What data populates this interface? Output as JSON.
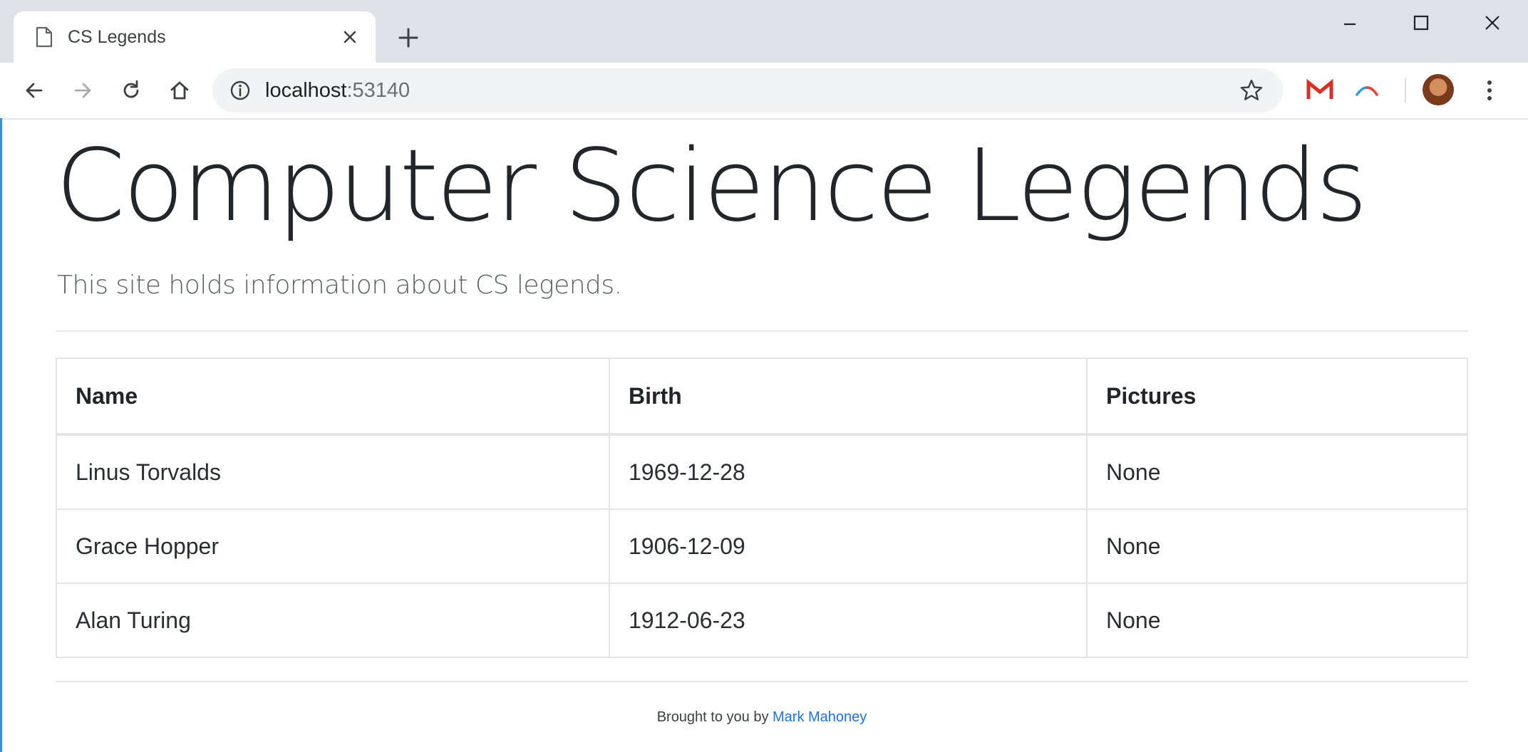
{
  "browser": {
    "tab": {
      "title": "CS Legends",
      "icon": "document-icon"
    },
    "address_bar": {
      "host": "localhost",
      "port": ":53140"
    }
  },
  "page": {
    "title": "Computer Science Legends",
    "lead": "This site holds information about CS legends.",
    "table": {
      "headers": [
        "Name",
        "Birth",
        "Pictures"
      ],
      "rows": [
        [
          "Linus Torvalds",
          "1969-12-28",
          "None"
        ],
        [
          "Grace Hopper",
          "1906-12-09",
          "None"
        ],
        [
          "Alan Turing",
          "1912-06-23",
          "None"
        ]
      ]
    },
    "footer": {
      "text": "Brought to you by ",
      "link": "Mark Mahoney"
    }
  },
  "colors": {
    "link": "#1a73e8",
    "gmail_red": "#d93025",
    "window_accent": "#3b8ed8"
  }
}
